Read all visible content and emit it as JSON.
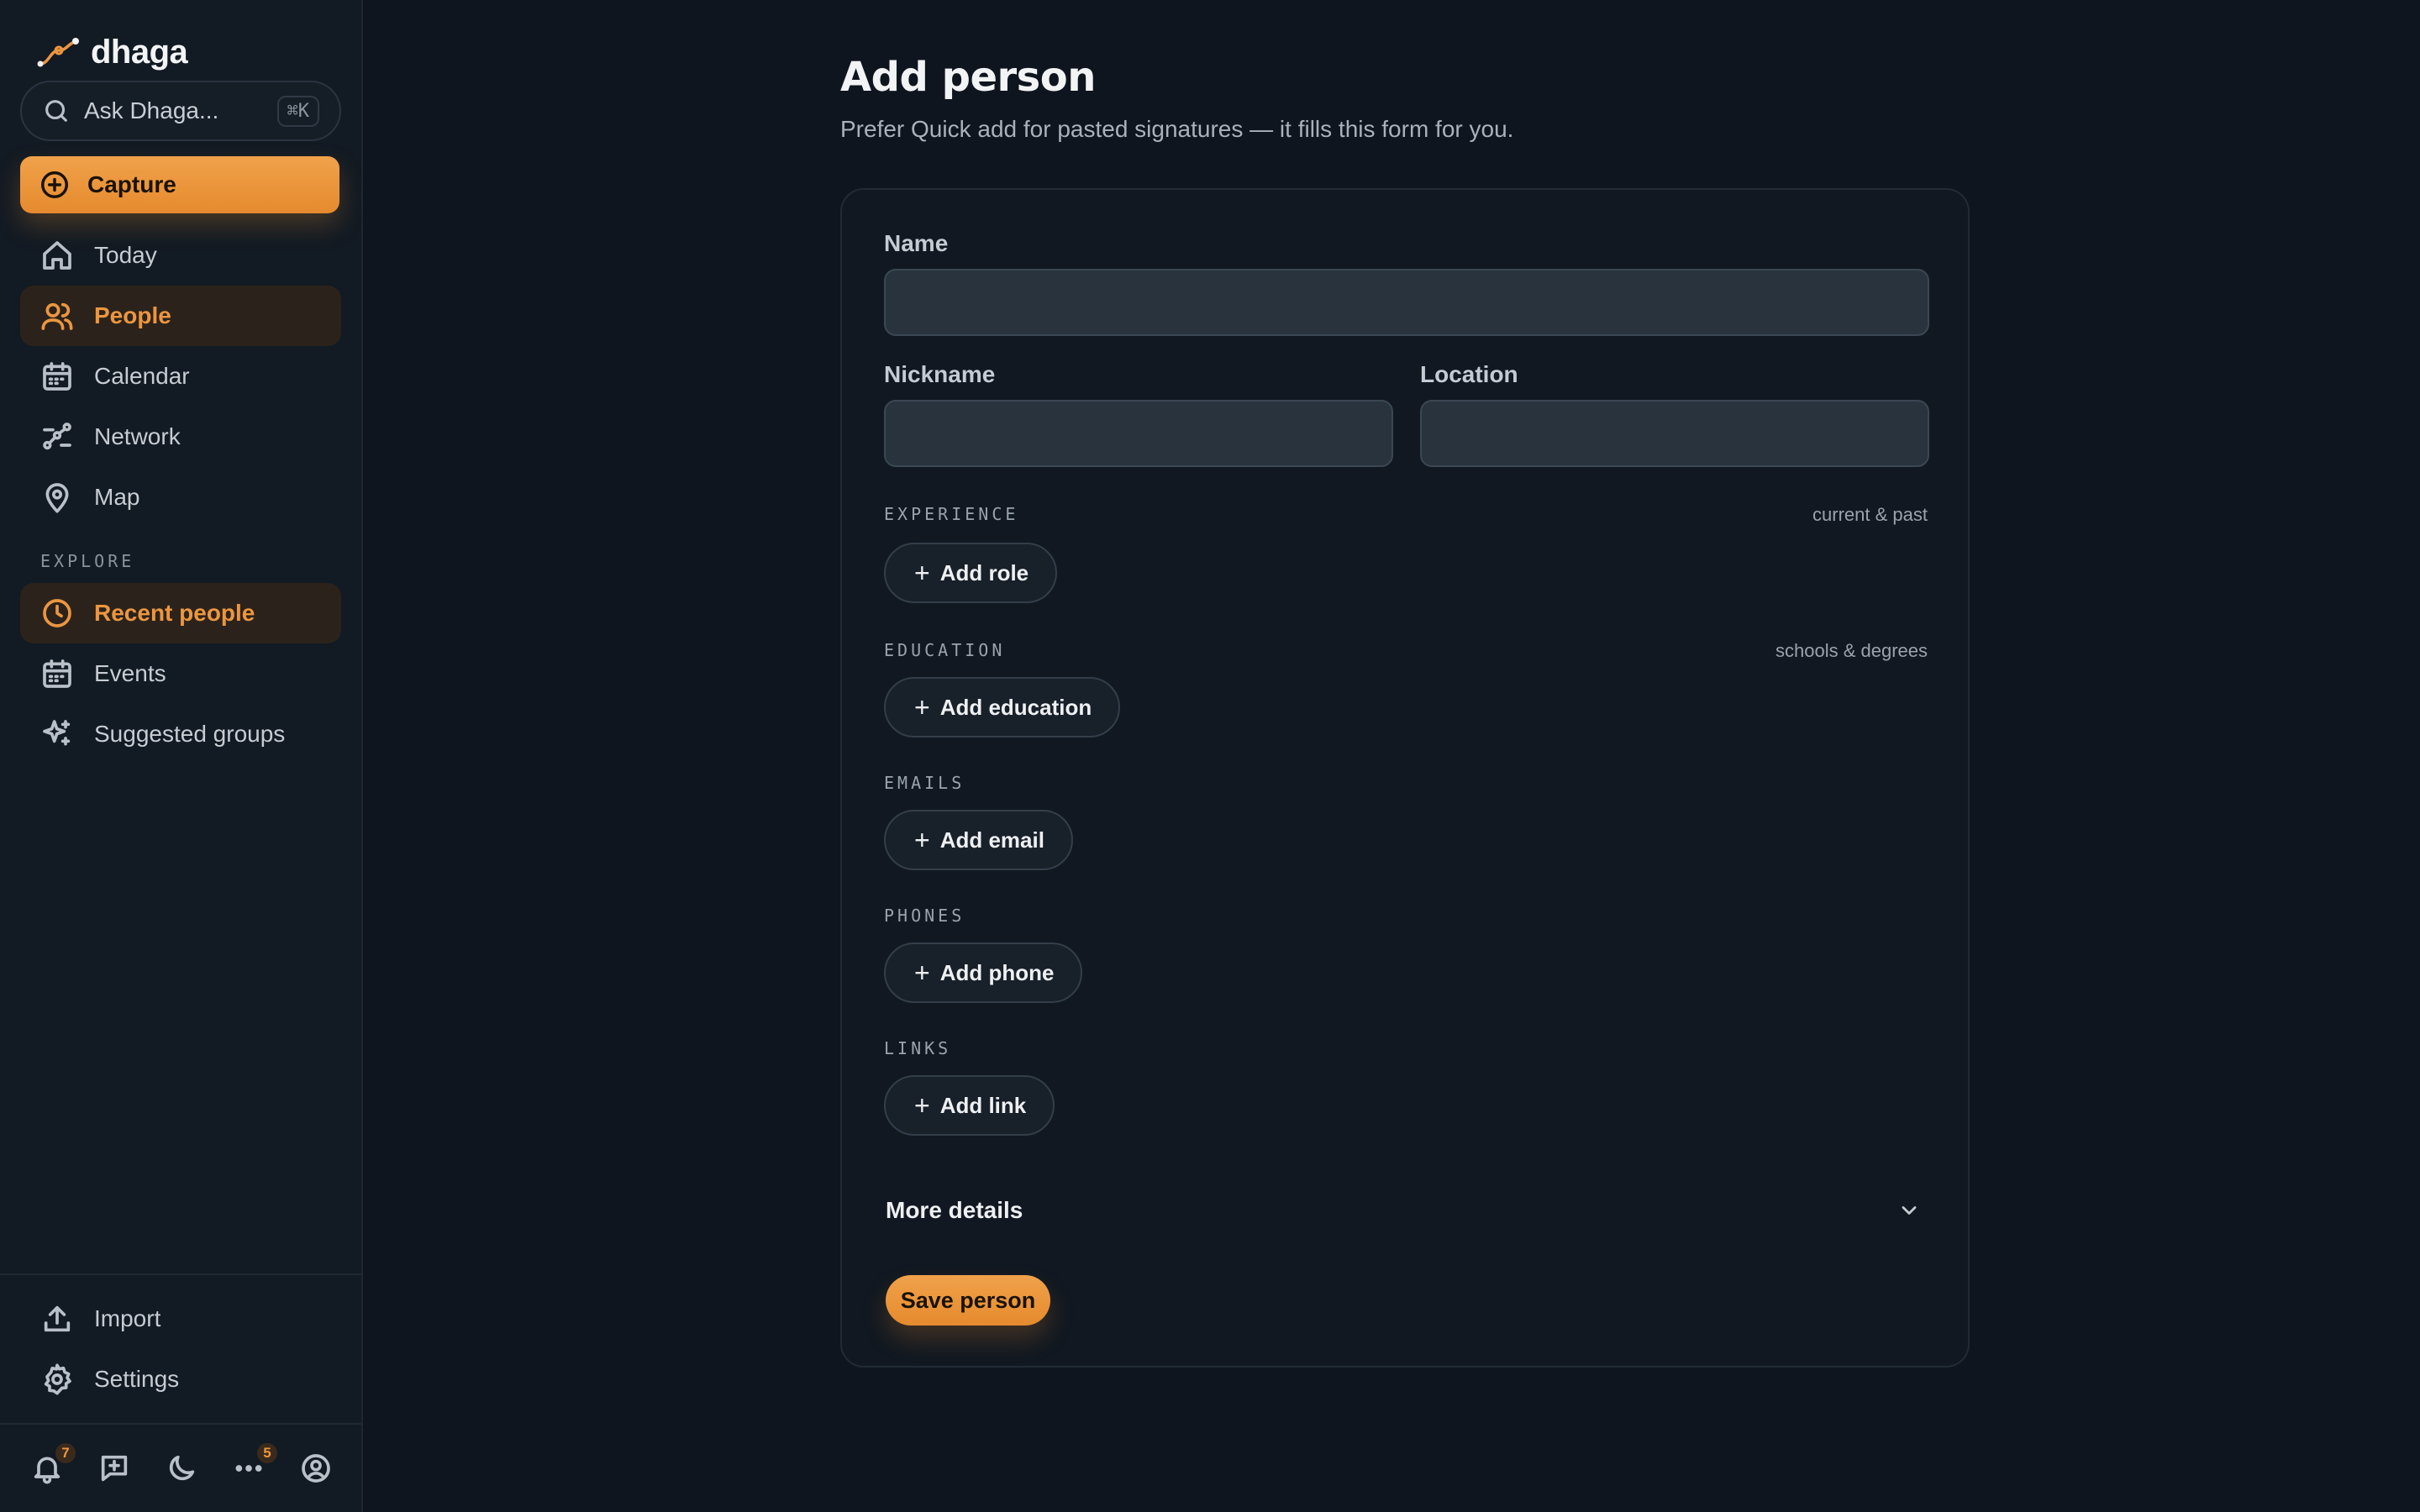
{
  "app": {
    "name": "dhaga"
  },
  "sidebar": {
    "search": {
      "placeholder": "Ask Dhaga...",
      "shortcut": "⌘K"
    },
    "capture_label": "Capture",
    "nav": [
      {
        "label": "Today",
        "icon": "home-icon"
      },
      {
        "label": "People",
        "icon": "users-icon",
        "active": true
      },
      {
        "label": "Calendar",
        "icon": "calendar-icon"
      },
      {
        "label": "Network",
        "icon": "network-icon"
      },
      {
        "label": "Map",
        "icon": "map-pin-icon"
      }
    ],
    "explore_label": "EXPLORE",
    "explore": [
      {
        "label": "Recent people",
        "icon": "clock-icon",
        "active": true
      },
      {
        "label": "Events",
        "icon": "calendar-icon"
      },
      {
        "label": "Suggested groups",
        "icon": "sparkles-icon"
      }
    ],
    "footer": [
      {
        "label": "Import",
        "icon": "upload-icon"
      },
      {
        "label": "Settings",
        "icon": "gear-icon"
      }
    ],
    "bottom_bar": {
      "notifications_count": "7",
      "more_count": "5"
    }
  },
  "main": {
    "title": "Add person",
    "subtitle": "Prefer Quick add for pasted signatures — it fills this form for you.",
    "form": {
      "name_label": "Name",
      "name_value": "",
      "nickname_label": "Nickname",
      "nickname_value": "",
      "location_label": "Location",
      "location_value": "",
      "sections": [
        {
          "title": "EXPERIENCE",
          "hint": "current & past",
          "button": "Add role"
        },
        {
          "title": "EDUCATION",
          "hint": "schools & degrees",
          "button": "Add education"
        },
        {
          "title": "EMAILS",
          "hint": "",
          "button": "Add email"
        },
        {
          "title": "PHONES",
          "hint": "",
          "button": "Add phone"
        },
        {
          "title": "LINKS",
          "hint": "",
          "button": "Add link"
        }
      ],
      "more_details_label": "More details",
      "save_label": "Save person"
    }
  },
  "colors": {
    "background": "#0f151e",
    "sidebar": "#121a23",
    "accent": "#ec9640",
    "card": "#111821",
    "input": "#28333d"
  }
}
